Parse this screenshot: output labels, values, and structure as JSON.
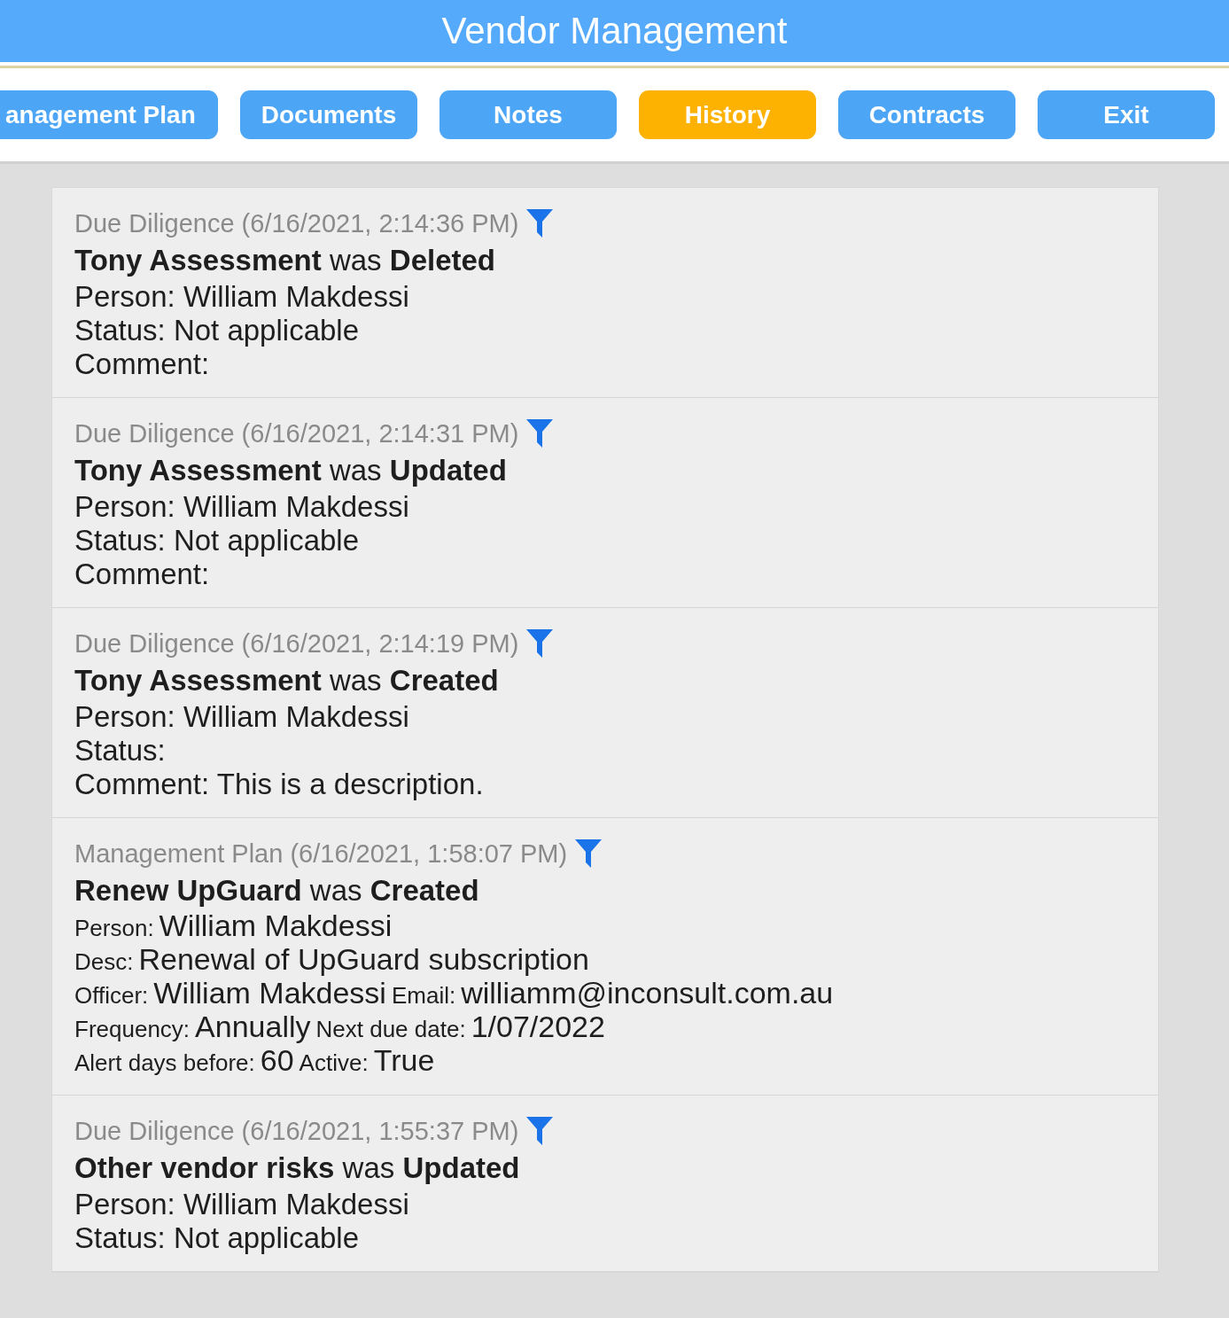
{
  "header": {
    "title": "Vendor Management"
  },
  "tabs": [
    {
      "label": "anagement Plan",
      "selected": false
    },
    {
      "label": "Documents",
      "selected": false
    },
    {
      "label": "Notes",
      "selected": false
    },
    {
      "label": "History",
      "selected": true
    },
    {
      "label": "Contracts",
      "selected": false
    },
    {
      "label": "Exit",
      "selected": false
    }
  ],
  "history": [
    {
      "kind": "change",
      "heading": "Due Diligence (6/16/2021, 2:14:36 PM)",
      "title": "**Tony Assessment** was **Deleted**",
      "lines": [
        "Person: William Makdessi",
        "Status: Not applicable",
        "Comment:"
      ]
    },
    {
      "kind": "change",
      "heading": "Due Diligence (6/16/2021, 2:14:31 PM)",
      "title": "**Tony Assessment** was **Updated**",
      "lines": [
        "Person: William Makdessi",
        "Status: Not applicable",
        "Comment:"
      ]
    },
    {
      "kind": "change",
      "heading": "Due Diligence (6/16/2021, 2:14:19 PM)",
      "title": "**Tony Assessment** was **Created**",
      "lines": [
        "Person: William Makdessi",
        "Status:",
        "Comment: This is a description."
      ]
    },
    {
      "kind": "plan",
      "heading": "Management Plan (6/16/2021, 1:58:07 PM)",
      "title": "**Renew UpGuard** was **Created**",
      "fields": [
        [
          {
            "label": "Person:",
            "value": "William Makdessi"
          }
        ],
        [
          {
            "label": "Desc:",
            "value": "Renewal of UpGuard subscription"
          }
        ],
        [
          {
            "label": "Officer:",
            "value": "William Makdessi"
          },
          {
            "label": "Email:",
            "value": "williamm@inconsult.com.au"
          }
        ],
        [
          {
            "label": "Frequency:",
            "value": "Annually"
          },
          {
            "label": "Next due date:",
            "value": "1/07/2022"
          }
        ],
        [
          {
            "label": "Alert days before:",
            "value": "60"
          },
          {
            "label": "Active:",
            "value": "True"
          }
        ]
      ]
    },
    {
      "kind": "change",
      "heading": "Due Diligence (6/16/2021, 1:55:37 PM)",
      "title": "**Other vendor risks** was **Updated**",
      "lines": [
        "Person: William Makdessi",
        "Status: Not applicable"
      ]
    }
  ]
}
